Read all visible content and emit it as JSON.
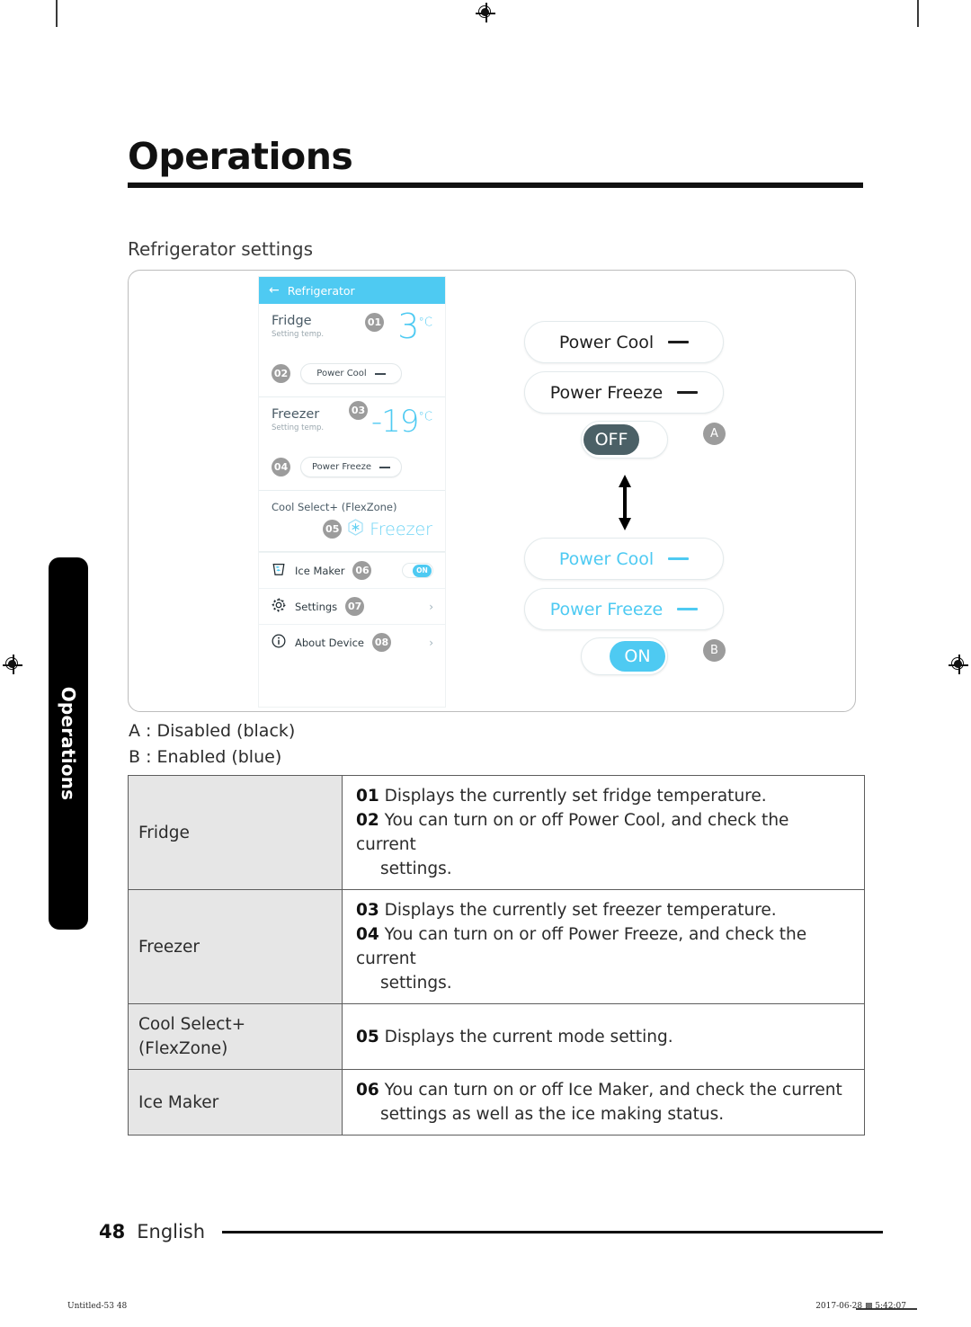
{
  "document": {
    "chapter_title": "Operations",
    "side_tab_label": "Operations",
    "section_label": "Refrigerator settings",
    "page_number": "48",
    "language": "English",
    "print_footer_left": "Untitled-53   48",
    "print_footer_right": "2017-06-28   ▩ 5:42:07"
  },
  "accent": {
    "blue": "#4ECAF2",
    "dark_toggle": "#4B6066",
    "badge_gray": "#9C9C9C",
    "table_key_bg": "#E6E6E6"
  },
  "phone": {
    "appbar": {
      "back_icon": "arrow-left-icon",
      "title": "Refrigerator"
    },
    "fridge": {
      "name": "Fridge",
      "sub": "Setting temp.",
      "badge_temp": "01",
      "temp_value": "3",
      "temp_unit": "°C",
      "badge_pill": "02",
      "pill_label": "Power Cool"
    },
    "freezer": {
      "name": "Freezer",
      "sub": "Setting temp.",
      "badge_temp": "03",
      "temp_value": "-19",
      "temp_unit": "°C",
      "badge_pill": "04",
      "pill_label": "Power Freeze"
    },
    "coolselect": {
      "name": "Cool Select+ (FlexZone)",
      "badge": "05",
      "mode_icon": "snowflake-hex-icon",
      "mode_value": "Freezer"
    },
    "rows": [
      {
        "icon": "ice-maker-icon",
        "label": "Ice Maker",
        "badge": "06",
        "control": "toggle",
        "toggle_state": "ON"
      },
      {
        "icon": "gear-icon",
        "label": "Settings",
        "badge": "07",
        "control": "chevron"
      },
      {
        "icon": "info-icon",
        "label": "About Device",
        "badge": "08",
        "control": "chevron"
      }
    ]
  },
  "callouts": {
    "disabled_group": {
      "power_cool": "Power Cool",
      "power_freeze": "Power Freeze",
      "switch_label": "OFF",
      "tag": "A"
    },
    "enabled_group": {
      "power_cool": "Power Cool",
      "power_freeze": "Power Freeze",
      "switch_label": "ON",
      "tag": "B"
    },
    "arrow_icon": "double-arrow-vertical-icon"
  },
  "legend": {
    "line_a": "A : Disabled (black)",
    "line_b": "B : Enabled (blue)"
  },
  "table": {
    "rows": [
      {
        "key": "Fridge",
        "items": [
          {
            "num": "01",
            "text": "Displays the currently set fridge temperature."
          },
          {
            "num": "02",
            "text": "You can turn on or off Power Cool, and check the current",
            "cont": "settings."
          }
        ]
      },
      {
        "key": "Freezer",
        "items": [
          {
            "num": "03",
            "text": "Displays the currently set freezer temperature."
          },
          {
            "num": "04",
            "text": "You can turn on or off Power Freeze, and check the current",
            "cont": "settings."
          }
        ]
      },
      {
        "key": "Cool Select+\n(FlexZone)",
        "key_line1": "Cool Select+",
        "key_line2": "(FlexZone)",
        "items": [
          {
            "num": "05",
            "text": "Displays the current mode setting."
          }
        ]
      },
      {
        "key": "Ice Maker",
        "items": [
          {
            "num": "06",
            "text": "You can turn on or off Ice Maker, and check the current",
            "cont": "settings as well as the ice making status."
          }
        ]
      }
    ]
  }
}
